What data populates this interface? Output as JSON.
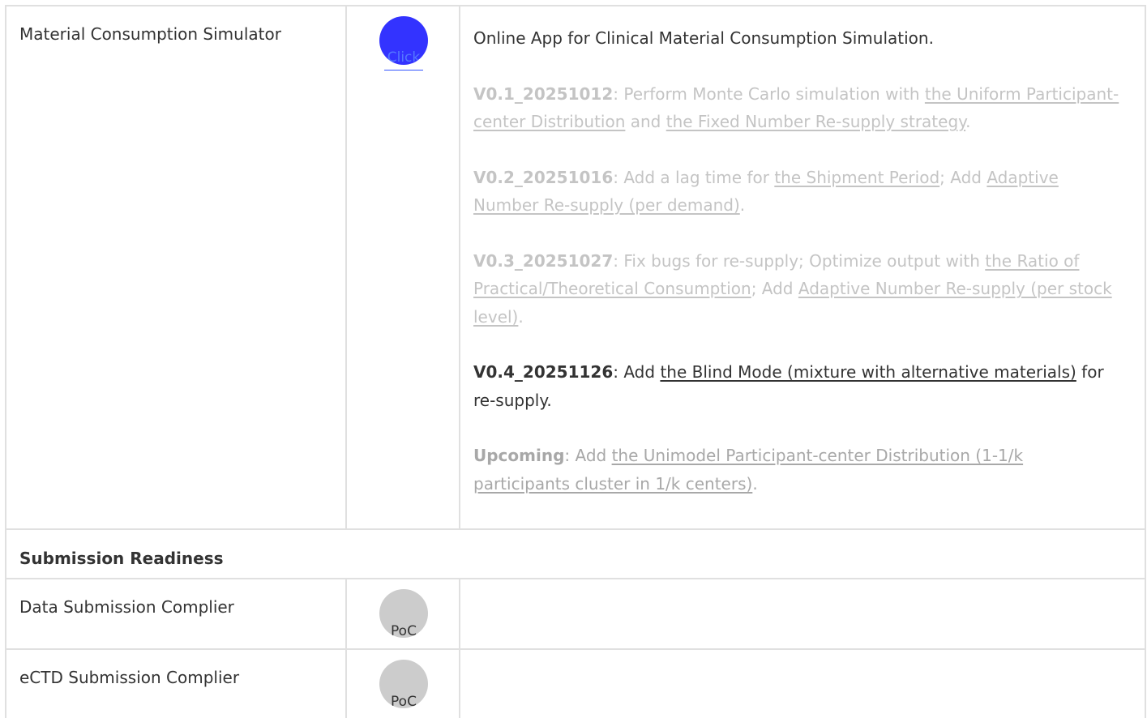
{
  "rows": {
    "material": {
      "name": "Material Consumption Simulator",
      "badge_label": "Click",
      "intro": "Online App for Clinical Material Consumption Simulation.",
      "v01": {
        "version": "V0.1_20251012",
        "t1": ": Perform Monte Carlo simulation with ",
        "link1": "the Uniform Participant-center Distribution",
        "t2": " and ",
        "link2": "the Fixed Number Re-supply strategy",
        "t3": "."
      },
      "v02": {
        "version": "V0.2_20251016",
        "t1": ": Add a lag time for ",
        "link1": "the Shipment Period",
        "t2": "; Add ",
        "link2": "Adaptive Number Re-supply (per demand)",
        "t3": "."
      },
      "v03": {
        "version": "V0.3_20251027",
        "t1": ": Fix bugs for re-supply; Optimize output with ",
        "link1": "the Ratio of Practical/Theoretical Consumption",
        "t2": "; Add ",
        "link2": "Adaptive Number Re-supply (per stock level)",
        "t3": "."
      },
      "v04": {
        "version": "V0.4_20251126",
        "t1": ": Add ",
        "link1": "the Blind Mode (mixture with alternative materials)",
        "t2": " for re-supply."
      },
      "upcoming": {
        "version": "Upcoming",
        "t1": ": Add ",
        "link1": "the Unimodel Participant-center Distribution (1-1/k participants cluster in 1/k centers)",
        "t2": "."
      }
    },
    "section": {
      "title": "Submission Readiness"
    },
    "data_submission": {
      "name": "Data Submission Complier",
      "badge_label": "PoC"
    },
    "ectd_submission": {
      "name": "eCTD Submission Complier",
      "badge_label": "PoC"
    }
  },
  "colors": {
    "click_badge": "#3333ff",
    "poc_badge": "#cccccc",
    "border": "#e0e0e0",
    "text": "#333333",
    "muted_text": "#c4c4c4"
  }
}
